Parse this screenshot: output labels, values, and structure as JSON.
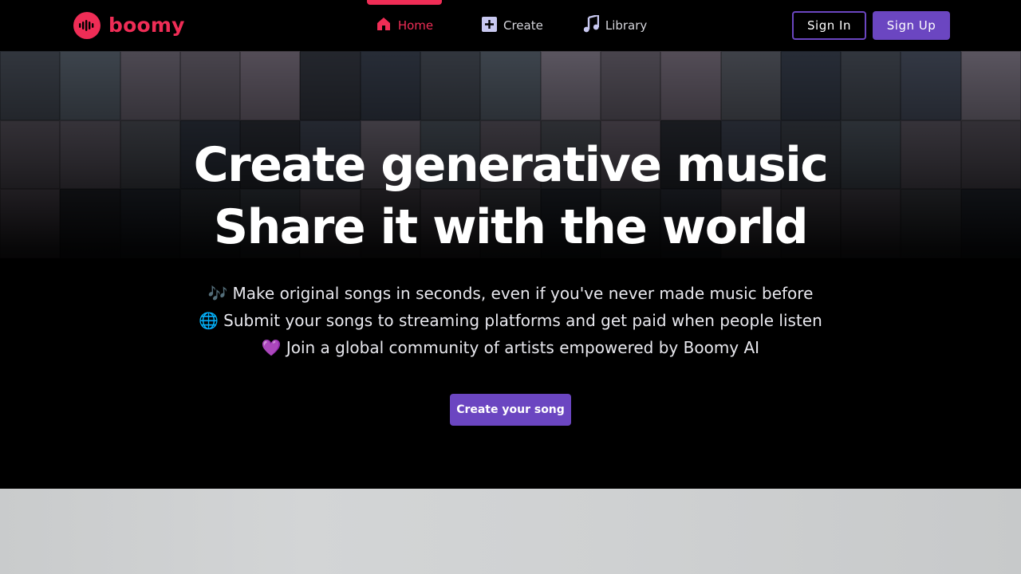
{
  "brand": {
    "name": "boomy",
    "color": "#ef2d56"
  },
  "nav": {
    "items": [
      {
        "label": "Home",
        "icon": "home-icon",
        "active": true
      },
      {
        "label": "Create",
        "icon": "plus-square-icon",
        "active": false
      },
      {
        "label": "Library",
        "icon": "music-note-icon",
        "active": false
      }
    ]
  },
  "auth": {
    "sign_in": "Sign In",
    "sign_up": "Sign Up",
    "accent": "#6b46c1"
  },
  "hero": {
    "headline_1": "Create generative music",
    "headline_2": "Share it with the world",
    "bullets": [
      {
        "emoji": "🎶",
        "text": "Make original songs in seconds, even if you've never made music before"
      },
      {
        "emoji": "🌐",
        "text": "Submit your songs to streaming platforms and get paid when people listen"
      },
      {
        "emoji": "💜",
        "text": "Join a global community of artists empowered by Boomy AI"
      }
    ],
    "cta": "Create your song"
  }
}
